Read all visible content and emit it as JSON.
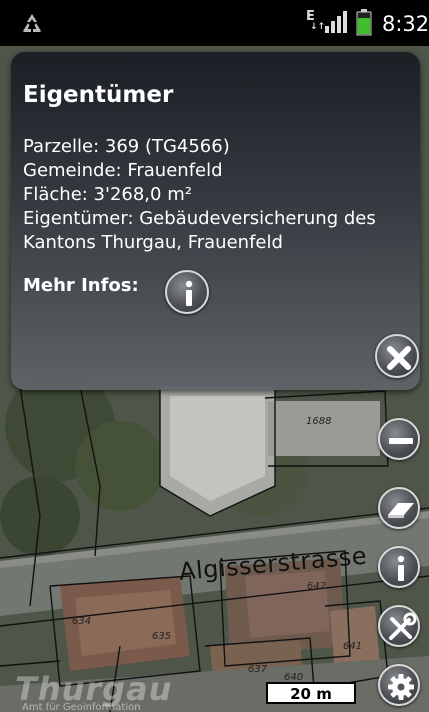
{
  "status_bar": {
    "time": "8:32",
    "network": "E",
    "icons": [
      "recycle-icon",
      "signal-icon",
      "battery-icon"
    ]
  },
  "popup": {
    "title": "Eigentümer",
    "parzelle": "Parzelle: 369 (TG4566)",
    "gemeinde": "Gemeinde: Frauenfeld",
    "flaeche": "Fläche: 3'268,0 m²",
    "eigentuemer_line1": "Eigentümer: Gebäudeversicherung des",
    "eigentuemer_line2": "Kantons Thurgau, Frauenfeld",
    "more_label": "Mehr Infos:"
  },
  "map": {
    "street": "Algisserstrasse",
    "parcels": [
      "1688",
      "642",
      "634",
      "635",
      "637",
      "640",
      "641"
    ],
    "logo": "Thurgau",
    "logo_sub": "Amt für Geoinformation",
    "scale": "20 m"
  },
  "toolbar": {
    "buttons": [
      "zoom-out",
      "erase",
      "info",
      "tools",
      "settings"
    ]
  },
  "colors": {
    "popup_bg": "#2e3338",
    "button_border": "#d9d9d9",
    "battery": "#3fbf2a"
  }
}
